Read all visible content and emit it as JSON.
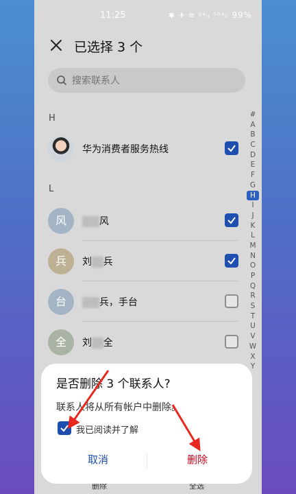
{
  "status": {
    "time": "11:25",
    "icons": "✱ ✈ ≋ ᵍᵃᵢₗ ⁵ᴳᵃᵢₗ",
    "battery": "99%"
  },
  "header": {
    "title": "已选择 3 个"
  },
  "search": {
    "placeholder": "搜索联系人"
  },
  "sections": {
    "h": {
      "letter": "H"
    },
    "l": {
      "letter": "L"
    }
  },
  "contacts": [
    {
      "avatar_char": "",
      "name": "华为消费者服务热线",
      "checked": true
    },
    {
      "avatar_char": "风",
      "name_visible_1": "",
      "name_visible_2": "风",
      "checked": true
    },
    {
      "avatar_char": "兵",
      "name_visible_1": "刘",
      "name_visible_2": "兵",
      "checked": true
    },
    {
      "avatar_char": "台",
      "name_visible_1": "",
      "name_visible_2": "兵，手台",
      "checked": false
    },
    {
      "avatar_char": "全",
      "name_visible_1": "刘",
      "name_visible_2": "全",
      "checked": false
    }
  ],
  "alpha_index": [
    "#",
    "A",
    "B",
    "C",
    "D",
    "E",
    "F",
    "G",
    "H",
    "I",
    "J",
    "K",
    "L",
    "M",
    "N",
    "O",
    "P",
    "Q",
    "R",
    "S",
    "T",
    "U",
    "V",
    "W",
    "X",
    "Y"
  ],
  "alpha_active": "H",
  "bottom": {
    "delete_label": "删除",
    "select_all_label": "全选"
  },
  "dialog": {
    "title": "是否删除 3 个联系人?",
    "message": "联系人将从所有帐户中删除。",
    "checkbox_label": "我已阅读并了解",
    "cancel_label": "取消",
    "delete_label": "删除"
  },
  "colors": {
    "accent": "#1e4fae",
    "danger": "#d0021b",
    "arrow": "#e8281e"
  }
}
